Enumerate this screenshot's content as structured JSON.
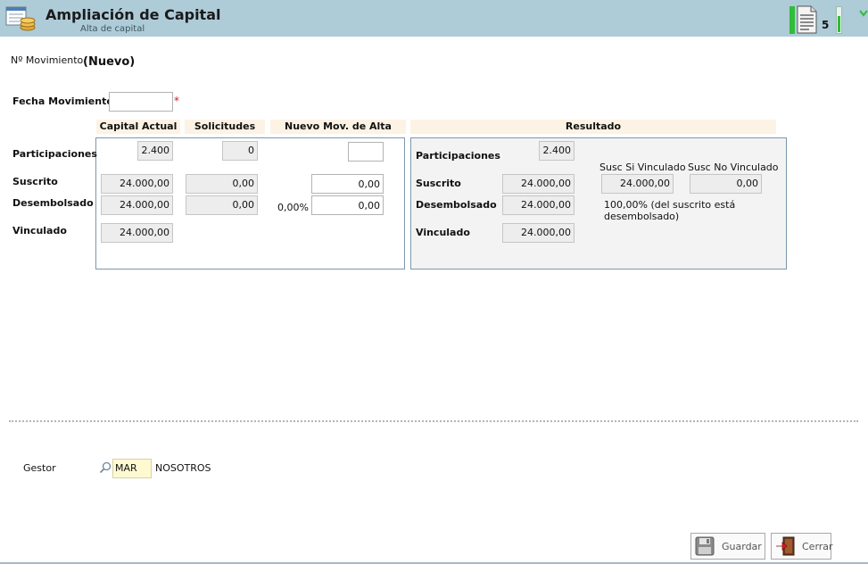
{
  "header": {
    "title": "Ampliación de Capital",
    "subtitle": "Alta de capital",
    "counter": "5",
    "app_icon": "spreadsheet-coins-icon",
    "doc_icon": "document-icon",
    "tick_icon": "chevron-down-icon"
  },
  "movement": {
    "label": "Nº Movimiento",
    "value": "(Nuevo)"
  },
  "date": {
    "label": "Fecha Movimiento",
    "value": "",
    "required_mark": "*"
  },
  "columns": {
    "capital_actual": "Capital Actual",
    "solicitudes": "Solicitudes",
    "nuevo_mov": "Nuevo Mov. de Alta",
    "resultado": "Resultado"
  },
  "rows": {
    "participaciones": "Participaciones",
    "suscrito": "Suscrito",
    "desembolsado": "Desembolsado",
    "vinculado": "Vinculado"
  },
  "capital_actual": {
    "participaciones": "2.400",
    "suscrito": "24.000,00",
    "desembolsado": "24.000,00",
    "vinculado": "24.000,00"
  },
  "solicitudes": {
    "participaciones": "0",
    "suscrito": "0,00",
    "desembolsado": "0,00"
  },
  "nuevo_mov": {
    "participaciones": "",
    "suscrito": "0,00",
    "desembolsado": "0,00",
    "desembolsado_pct": "0,00%"
  },
  "resultado": {
    "participaciones": "2.400",
    "suscrito": "24.000,00",
    "desembolsado": "24.000,00",
    "vinculado": "24.000,00",
    "susc_si_label": "Susc Si Vinculado",
    "susc_no_label": "Susc No Vinculado",
    "susc_si_value": "24.000,00",
    "susc_no_value": "0,00",
    "note_line1": "100,00% (del suscrito está",
    "note_line2": "desembolsado)"
  },
  "gestor": {
    "label": "Gestor",
    "code": "MAR",
    "name": "NOSOTROS",
    "icon": "magnifier-icon"
  },
  "buttons": {
    "guardar": "Guardar",
    "cerrar": "Cerrar",
    "guardar_icon": "floppy-disk-icon",
    "cerrar_icon": "exit-door-icon"
  }
}
